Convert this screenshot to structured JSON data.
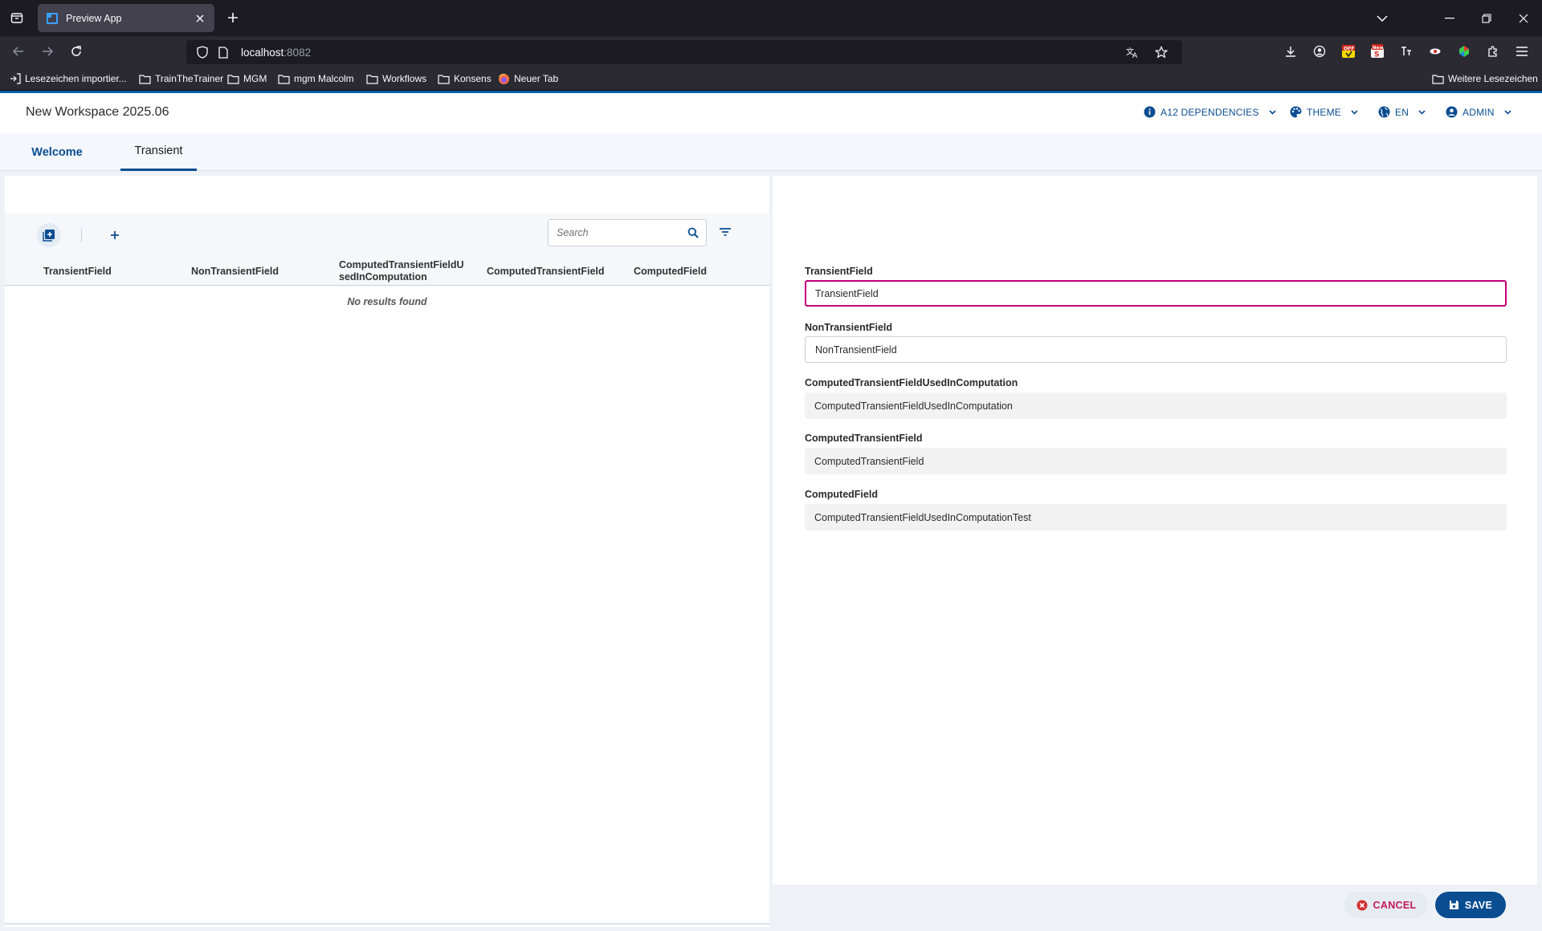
{
  "browser": {
    "tab_title": "Preview App",
    "url_host": "localhost",
    "url_port": ":8082",
    "bookmarks": [
      {
        "label": "Lesezeichen importier...",
        "icon": "import-icon"
      },
      {
        "label": "TrainTheTrainer",
        "icon": "folder-icon"
      },
      {
        "label": "MGM",
        "icon": "folder-icon"
      },
      {
        "label": "mgm Malcolm",
        "icon": "folder-icon"
      },
      {
        "label": "Workflows",
        "icon": "folder-icon"
      },
      {
        "label": "Konsens",
        "icon": "folder-icon"
      },
      {
        "label": "Neuer Tab",
        "icon": "firefox-icon"
      }
    ],
    "other_bookmarks": "Weitere Lesezeichen",
    "extension_badges": [
      "OFF",
      "New"
    ]
  },
  "app": {
    "workspace_title": "New Workspace 2025.06",
    "menus": {
      "dependencies": "A12 DEPENDENCIES",
      "theme": "THEME",
      "language": "EN",
      "user": "ADMIN"
    },
    "tabs": {
      "welcome": "Welcome",
      "transient": "Transient"
    },
    "accent_color": "#0a4d91",
    "focus_color": "#c2007a"
  },
  "list": {
    "search_placeholder": "Search",
    "columns": {
      "c1": "TransientField",
      "c2": "NonTransientField",
      "c3": "ComputedTransientFieldU sedInComputation",
      "c4": "ComputedTransientField",
      "c5": "ComputedField"
    },
    "empty_message": "No results found"
  },
  "form": {
    "transient": {
      "label": "TransientField",
      "value": "TransientField"
    },
    "non_transient": {
      "label": "NonTransientField",
      "value": "NonTransientField"
    },
    "computed_used": {
      "label": "ComputedTransientFieldUsedInComputation",
      "value": "ComputedTransientFieldUsedInComputation"
    },
    "computed_transient": {
      "label": "ComputedTransientField",
      "value": "ComputedTransientField"
    },
    "computed": {
      "label": "ComputedField",
      "value": "ComputedTransientFieldUsedInComputationTest"
    }
  },
  "actions": {
    "cancel": "CANCEL",
    "save": "SAVE"
  }
}
